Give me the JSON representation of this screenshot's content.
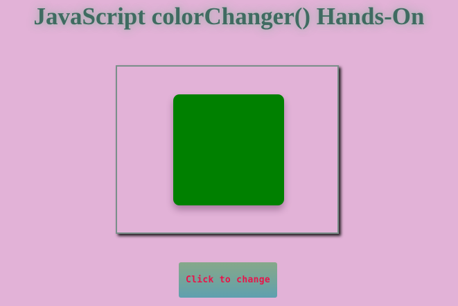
{
  "page": {
    "title": "JavaScript colorChanger() Hands-On",
    "background_color": "#e2b2d7",
    "title_color": "#3f6b61"
  },
  "color_box": {
    "current_color": "#008000"
  },
  "button": {
    "label": "Click to change",
    "text_color": "#e8144a"
  }
}
